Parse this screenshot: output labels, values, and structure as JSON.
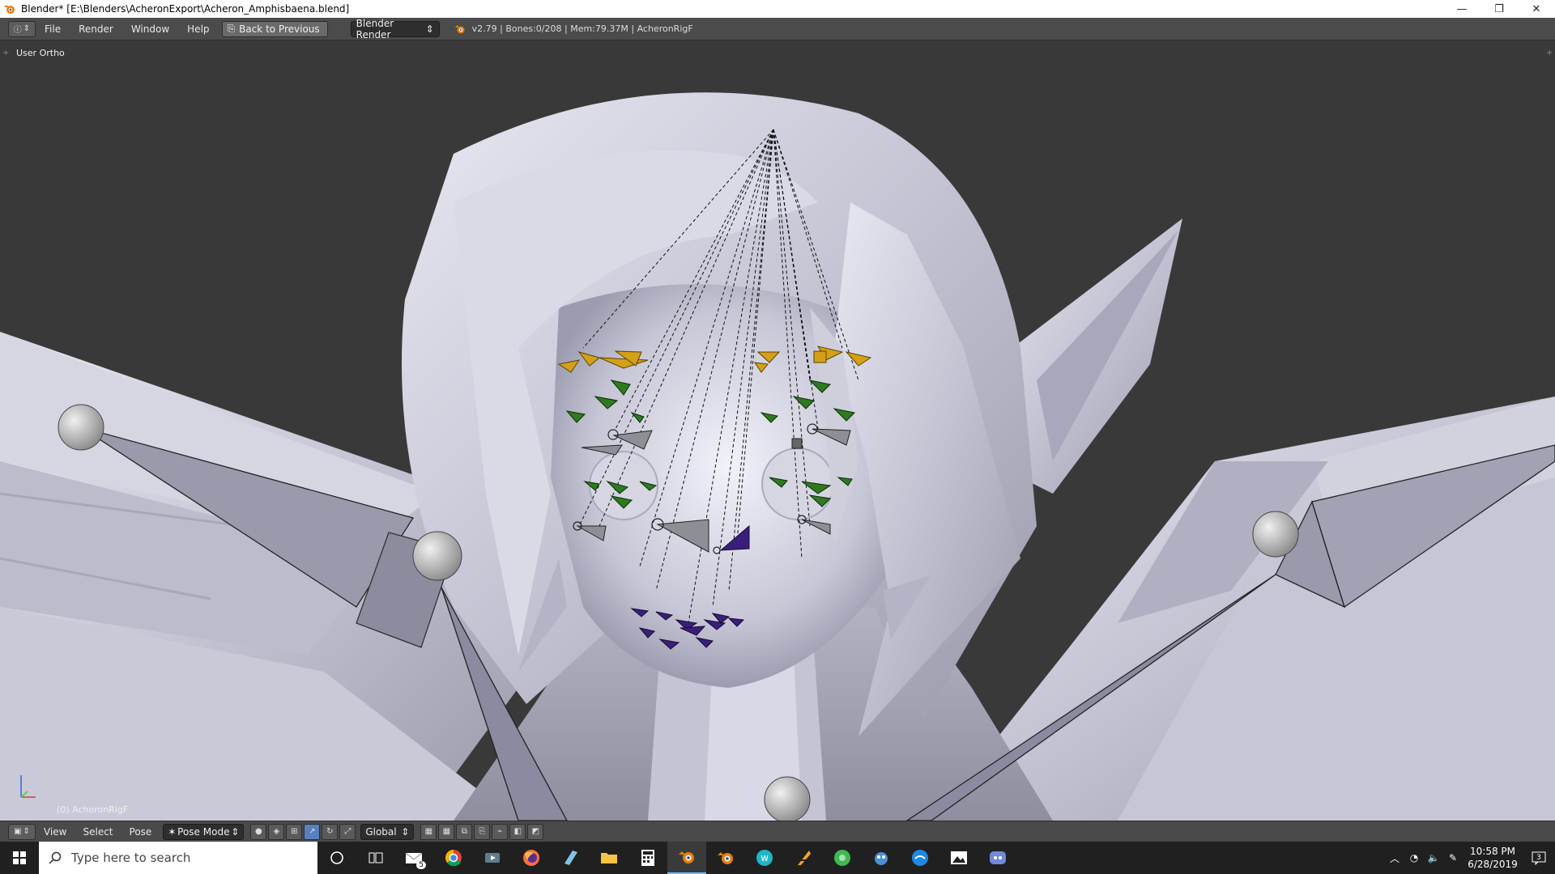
{
  "window": {
    "title": "Blender* [E:\\Blenders\\AcheronExport\\Acheron_Amphisbaena.blend]",
    "controls": {
      "minimize": "—",
      "restore": "❐",
      "close": "✕"
    }
  },
  "info_header": {
    "editor_icon": "info-icon",
    "menus": [
      "File",
      "Render",
      "Window",
      "Help"
    ],
    "back_button": "Back to Previous",
    "render_engine": "Blender Render",
    "stats": "v2.79 | Bones:0/208 | Mem:79.37M | AcheronRigF"
  },
  "viewport": {
    "view_label": "User Ortho",
    "object_label": "(0) AcheronRigF",
    "colors": {
      "background": "#393939",
      "mesh": "#c8c8d8",
      "bone_yellow": "#d4a017",
      "bone_green": "#2f7a1f",
      "bone_purple": "#3a1f7a"
    }
  },
  "view_header": {
    "editor_icon": "3d-view-icon",
    "menus": [
      "View",
      "Select",
      "Pose"
    ],
    "mode": "Pose Mode",
    "orientation": "Global"
  },
  "taskbar": {
    "search_placeholder": "Type here to search",
    "mail_badge": "5",
    "apps": [
      "cortana-icon",
      "task-view-icon",
      "mail-icon",
      "chrome-icon",
      "media-icon",
      "firefox-icon",
      "notepad-icon",
      "file-explorer-icon",
      "calculator-icon",
      "blender-icon",
      "blender-icon-2",
      "wattpad-icon",
      "sketch-icon",
      "chrome-green-icon",
      "app-icon",
      "paint-icon",
      "photos-icon",
      "discord-icon"
    ],
    "time": "10:58 PM",
    "date": "6/28/2019",
    "notification_count": "3"
  }
}
